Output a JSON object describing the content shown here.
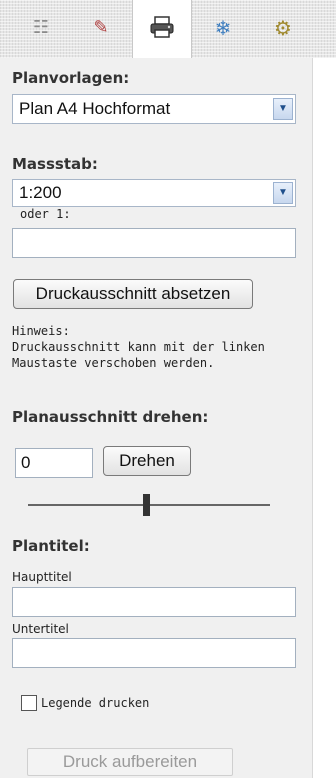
{
  "tabs": [
    {
      "icon": "list-icon",
      "glyph": "☷"
    },
    {
      "icon": "measure-icon",
      "glyph": "✎"
    },
    {
      "icon": "printer-icon",
      "glyph": "🖶"
    },
    {
      "icon": "snowflake-icon",
      "glyph": "❄"
    },
    {
      "icon": "wheel-icon",
      "glyph": "⚙"
    }
  ],
  "planvorlagen": {
    "label": "Planvorlagen:",
    "selected": "Plan A4 Hochformat"
  },
  "massstab": {
    "label": "Massstab:",
    "selected": "1:200",
    "oder_label": "oder 1:",
    "custom_value": ""
  },
  "druckausschnitt_button": "Druckausschnitt absetzen",
  "hinweis": {
    "title": "Hinweis:",
    "line1": "Druckausschnitt kann mit der linken",
    "line2": "Maustaste verschoben werden."
  },
  "drehen": {
    "label": "Planausschnitt drehen:",
    "value": "0",
    "button": "Drehen",
    "slider_level": 0.5
  },
  "plantitel": {
    "label": "Plantitel:",
    "haupttitel_label": "Haupttitel",
    "haupttitel_value": "",
    "untertitel_label": "Untertitel",
    "untertitel_value": ""
  },
  "legende": {
    "label": "Legende drucken",
    "checked": false
  },
  "druck_button": "Druck aufbereiten"
}
